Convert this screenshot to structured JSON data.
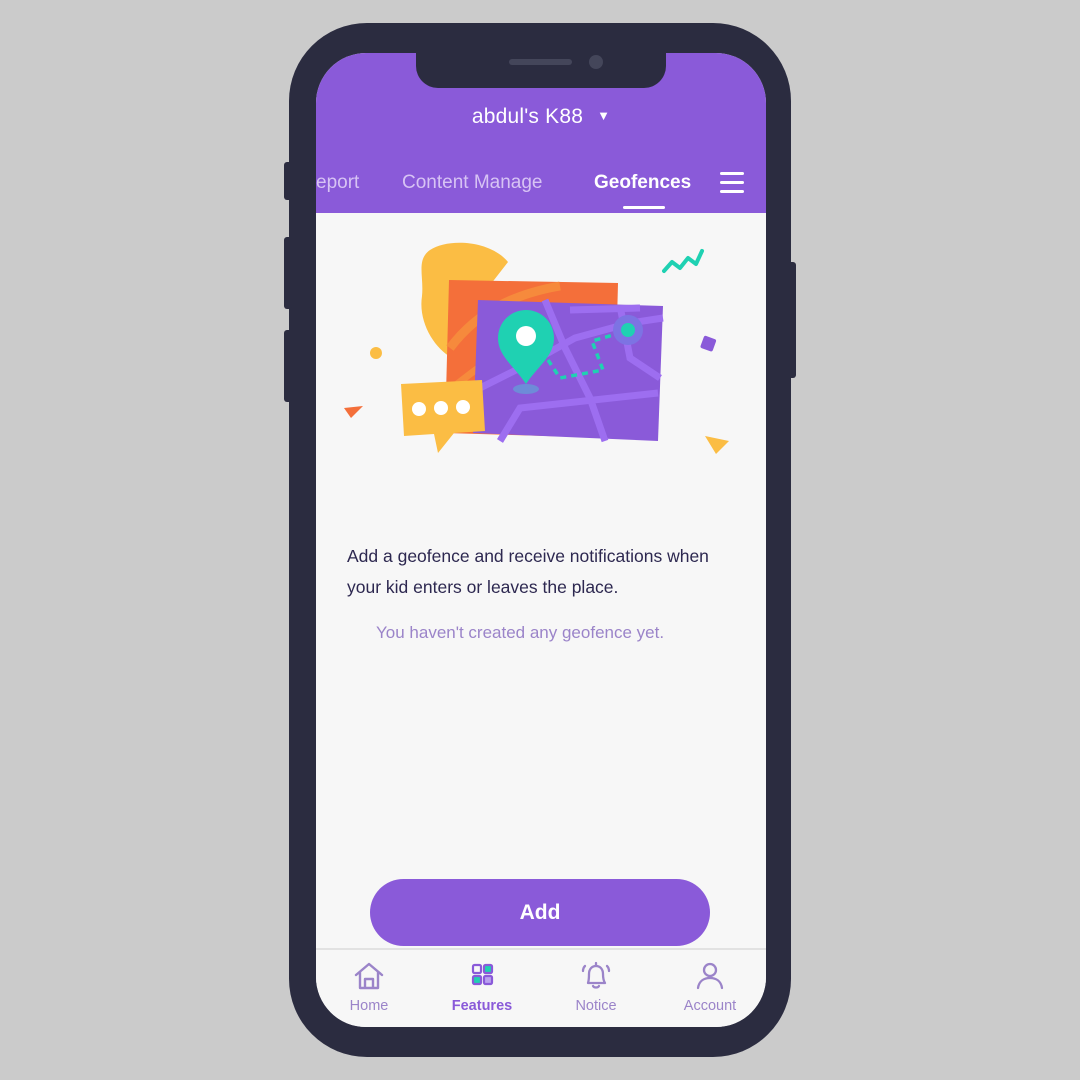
{
  "header": {
    "device_name": "abdul's K88",
    "device_dropdown_icon": "caret-down-icon",
    "tabs": [
      {
        "label": "eport",
        "active": false
      },
      {
        "label": "Content Manage",
        "active": false
      },
      {
        "label": "Geofences",
        "active": true
      }
    ],
    "menu_icon": "hamburger-menu-icon"
  },
  "main": {
    "illustration": "geofence-map-illustration",
    "description": "Add a geofence and receive notifications when your kid enters or leaves the place.",
    "empty_state": "You haven't created any geofence yet.",
    "add_button_label": "Add"
  },
  "bottom_nav": {
    "items": [
      {
        "label": "Home",
        "icon": "home-icon",
        "active": false
      },
      {
        "label": "Features",
        "icon": "features-grid-icon",
        "active": true
      },
      {
        "label": "Notice",
        "icon": "bell-icon",
        "active": false
      },
      {
        "label": "Account",
        "icon": "user-icon",
        "active": false
      }
    ]
  },
  "colors": {
    "brand_purple": "#8a5ad9",
    "accent_teal": "#1fd1b2",
    "accent_orange": "#f46f3a",
    "accent_yellow": "#fbbd44",
    "phone_frame": "#2b2c40",
    "text_dark": "#2d2850",
    "text_muted": "#9b84c9"
  }
}
